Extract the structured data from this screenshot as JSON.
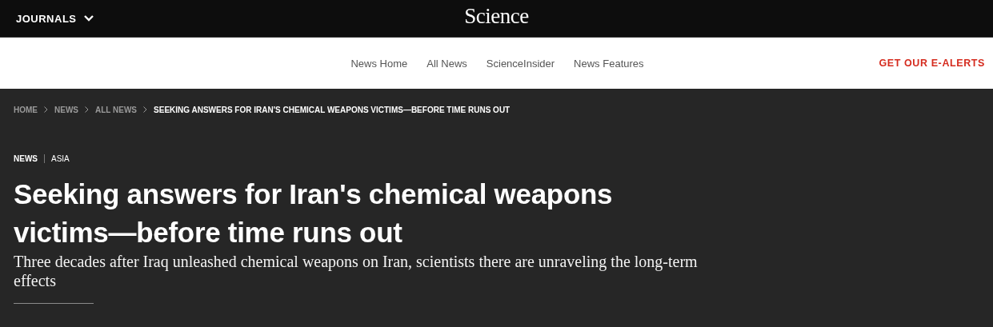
{
  "top_bar": {
    "journals_menu": "JOURNALS",
    "logo": "Science"
  },
  "nav": {
    "items": [
      {
        "label": "News Home"
      },
      {
        "label": "All News"
      },
      {
        "label": "ScienceInsider"
      },
      {
        "label": "News Features"
      }
    ],
    "alerts_link": "GET OUR E-ALERTS"
  },
  "breadcrumb": [
    {
      "label": "HOME",
      "current": false
    },
    {
      "label": "NEWS",
      "current": false
    },
    {
      "label": "ALL NEWS",
      "current": false
    },
    {
      "label": "SEEKING ANSWERS FOR IRAN'S CHEMICAL WEAPONS VICTIMS—BEFORE TIME RUNS OUT",
      "current": true
    }
  ],
  "article": {
    "tags": [
      "NEWS",
      "ASIA"
    ],
    "title": "Seeking answers for Iran's chemical weapons victims—before time runs out",
    "subtitle": "Three decades after Iraq unleashed chemical weapons on Iran, scientists there are unraveling the long-term effects"
  }
}
